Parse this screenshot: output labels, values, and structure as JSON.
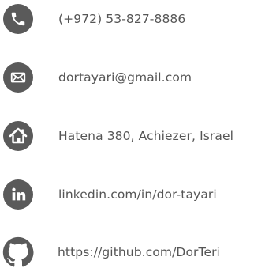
{
  "contacts": {
    "phone": {
      "text": "(+972) 53-827-8886",
      "icon": "phone-icon"
    },
    "email": {
      "text": "dortayari@gmail.com",
      "icon": "envelope-icon"
    },
    "address": {
      "text": "Hatena 380, Achiezer, Israel",
      "icon": "home-icon"
    },
    "linkedin": {
      "text": "linkedin.com/in/dor-tayari",
      "icon": "linkedin-icon"
    },
    "github": {
      "text": "https://github.com/DorTeri",
      "icon": "github-icon"
    }
  },
  "colors": {
    "icon": "#5a5a5a",
    "text": "#555555",
    "background": "#ffffff"
  }
}
